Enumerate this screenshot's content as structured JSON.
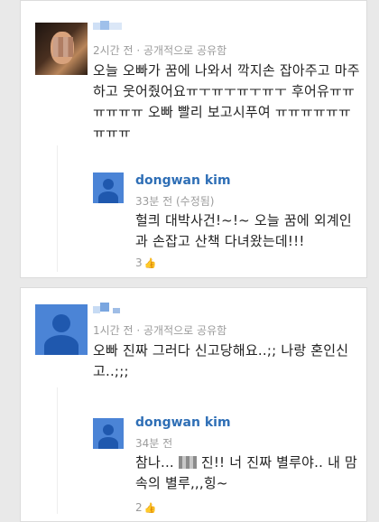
{
  "comments": [
    {
      "meta": "2시간 전  ·  공개적으로 공유함",
      "text": "오늘 오빠가 꿈에 나와서 깍지손 잡아주고 마주하고 웃어줬어요ㅠㅜㅠㅜㅠㅜㅠㅜ 후어유ㅠㅠㅠㅠㅠㅠ 오빠 빨리 보고시푸여 ㅠㅠㅠㅠㅠㅠㅠㅠㅠ",
      "reply": {
        "name": "dongwan kim",
        "meta": "33분 전 (수정됨)",
        "text": "헐킈 대박사건!~!~ 오늘 꿈에 외계인과 손잡고 산책 다녀왔는데!!!",
        "likes": "3"
      }
    },
    {
      "meta": "1시간 전  ·  공개적으로 공유함",
      "text": "오빠 진짜 그러다 신고당해요..;; 나랑 혼인신고..;;;",
      "reply": {
        "name": "dongwan kim",
        "meta": "34분 전",
        "text_before": "참나... ",
        "text_after": " 진!! 너 진짜 별루야.. 내 맘속의 별루,,,힝~",
        "likes": "2"
      }
    }
  ],
  "icons": {
    "thumb": "thumbs-up-icon",
    "avatar": "default-profile-icon"
  },
  "colors": {
    "reply_name": "#2f6fb6",
    "avatar_bg": "#4b84d6",
    "meta": "#9c9c9c"
  }
}
